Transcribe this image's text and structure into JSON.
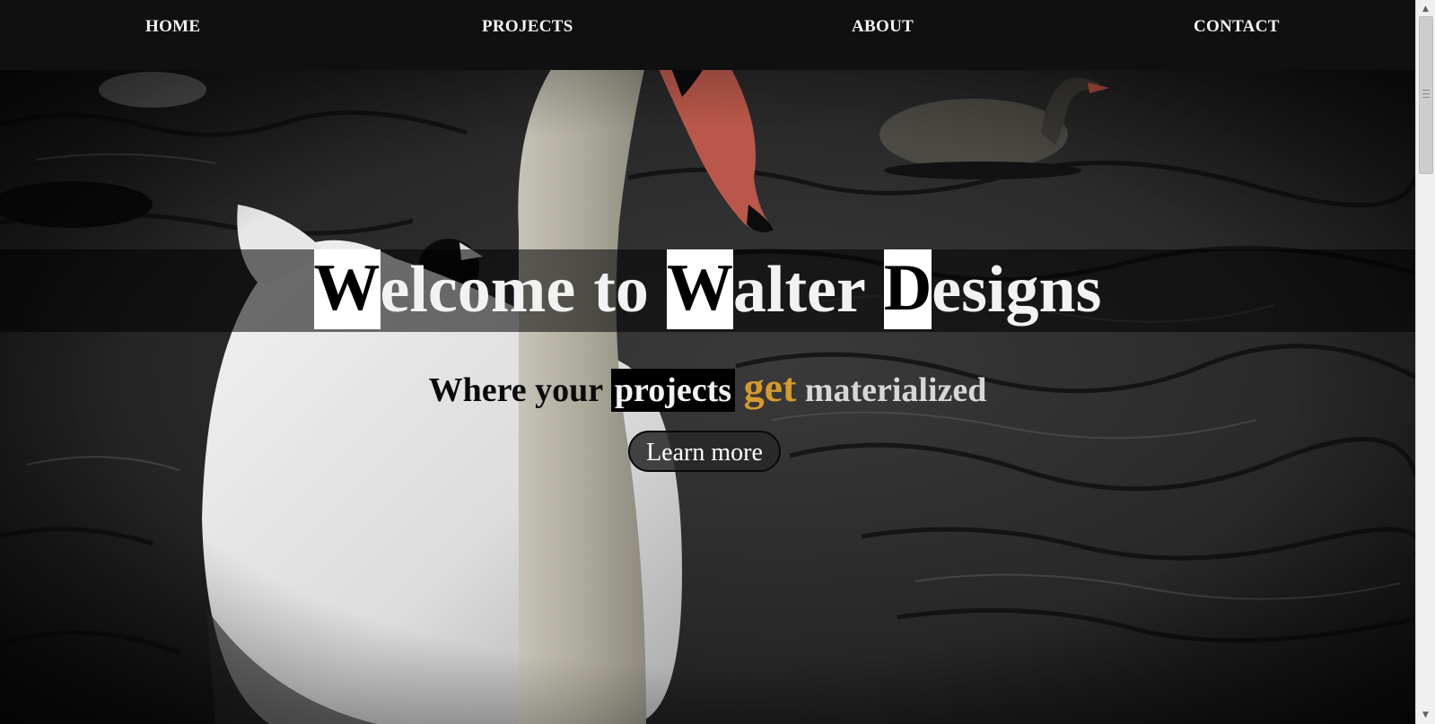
{
  "nav": {
    "items": [
      {
        "label": "HOME"
      },
      {
        "label": "PROJECTS"
      },
      {
        "label": "ABOUT"
      },
      {
        "label": "CONTACT"
      }
    ]
  },
  "hero": {
    "title": {
      "word1_cap": "W",
      "word1_rest": "elcome",
      "word2": "to",
      "word3_cap": "W",
      "word3_rest": "alter",
      "word4_cap": "D",
      "word4_rest": "esigns"
    },
    "subtitle": {
      "part1": "Where your",
      "part2": "projects",
      "part3": "get",
      "part4": "materialized"
    },
    "button_label": "Learn more"
  },
  "colors": {
    "nav_bg": "#0f100f",
    "accent_gold": "#d69a2c",
    "title_text": "#f2f2f2"
  },
  "icons": {
    "scroll_up": "scroll-up-arrow-icon",
    "scroll_down": "scroll-down-arrow-icon",
    "scroll_grip": "scroll-grip-icon"
  }
}
